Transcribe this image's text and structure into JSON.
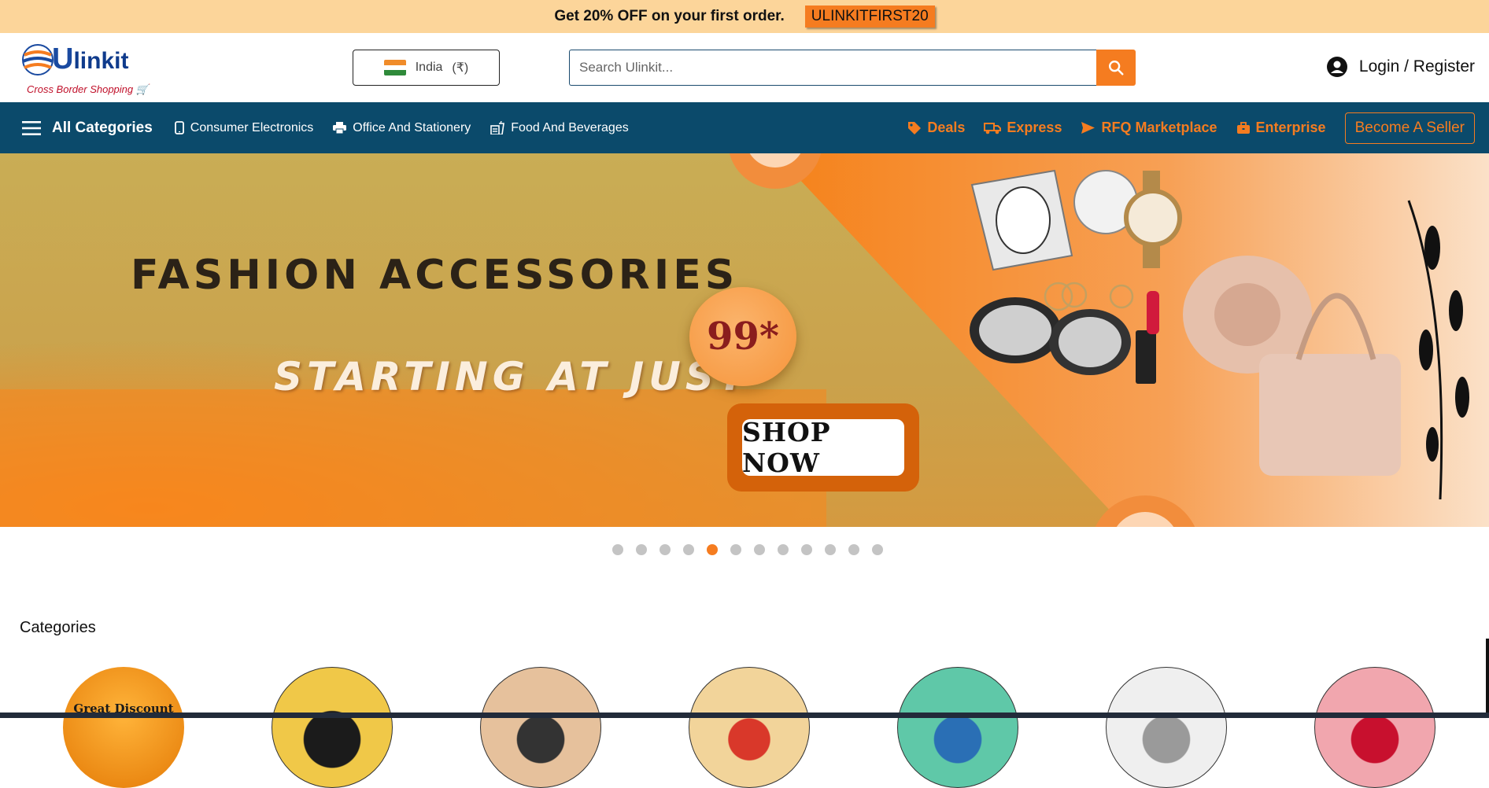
{
  "promo": {
    "text": "Get 20% OFF on your first order.",
    "code": "ULINKITFIRST20"
  },
  "header": {
    "logo": {
      "brand_first": "U",
      "brand_rest": "linkit",
      "tagline": "Cross Border Shopping"
    },
    "country": {
      "label": "India",
      "currency": "(₹)"
    },
    "search": {
      "placeholder": "Search Ulinkit..."
    },
    "login_label": "Login / Register"
  },
  "nav": {
    "all_categories": "All Categories",
    "items": [
      {
        "label": "Consumer Electronics",
        "icon": "phone-icon"
      },
      {
        "label": "Office And Stationery",
        "icon": "printer-icon"
      },
      {
        "label": "Food And Beverages",
        "icon": "food-icon"
      }
    ],
    "right_items": [
      {
        "label": "Deals",
        "icon": "tag-icon"
      },
      {
        "label": "Express",
        "icon": "truck-icon"
      },
      {
        "label": "RFQ Marketplace",
        "icon": "send-icon"
      },
      {
        "label": "Enterprise",
        "icon": "briefcase-icon"
      }
    ],
    "seller_button": "Become A Seller"
  },
  "banner": {
    "headline": "FASHION ACCESSORIES",
    "subline": "STARTING AT JUST",
    "price": "99*",
    "cta": "SHOP NOW",
    "slides_total": 12,
    "active_slide": 5
  },
  "categories": {
    "title": "Categories",
    "first_label": "Great Discount"
  },
  "colors": {
    "accent": "#f57c20",
    "nav_bg": "#0b4a6b",
    "promo_bg": "#fcd59a"
  }
}
